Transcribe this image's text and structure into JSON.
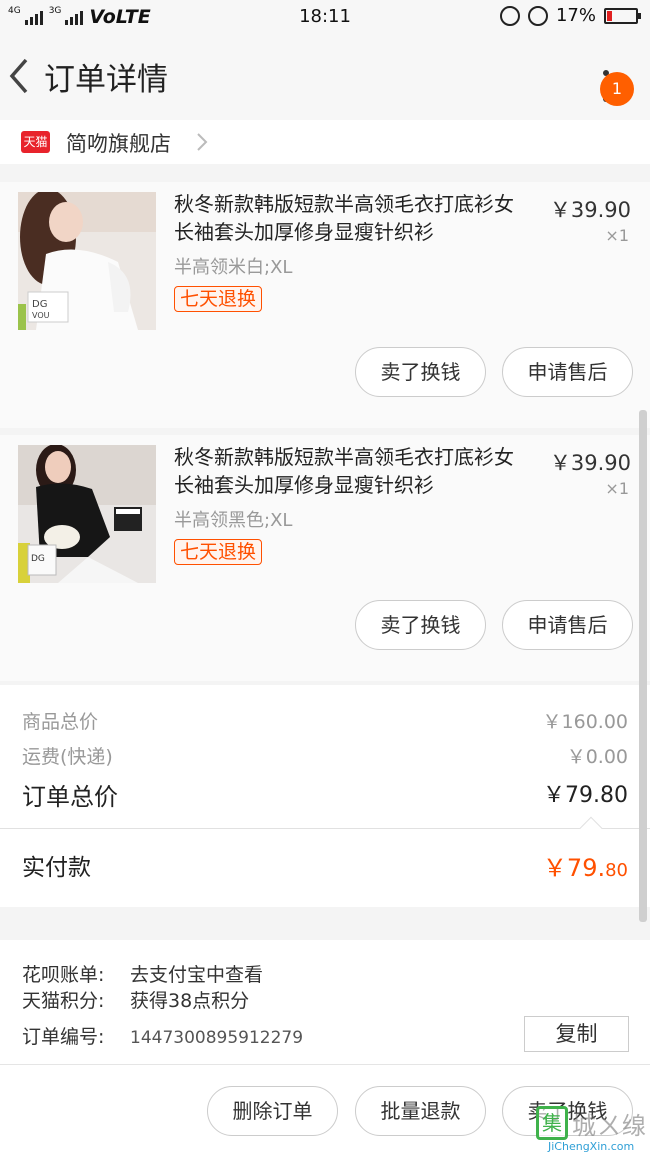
{
  "status_bar": {
    "network_1": "4G",
    "network_2": "3G",
    "volte": "VoLTE",
    "time": "18:11",
    "battery_percent": "17%",
    "battery_level": 0.17
  },
  "nav": {
    "title": "订单详情",
    "badge_count": "1"
  },
  "store": {
    "tmall_badge": "天猫",
    "name": "简吻旗舰店"
  },
  "items": [
    {
      "title": "秋冬新款韩版短款半高领毛衣打底衫女长袖套头加厚修身显瘦针织衫",
      "sku": "半高领米白;XL",
      "tag": "七天退换",
      "price": "￥39.90",
      "qty": "×1",
      "action_sell": "卖了换钱",
      "action_after_sale": "申请售后"
    },
    {
      "title": "秋冬新款韩版短款半高领毛衣打底衫女长袖套头加厚修身显瘦针织衫",
      "sku": "半高领黑色;XL",
      "tag": "七天退换",
      "price": "￥39.90",
      "qty": "×1",
      "action_sell": "卖了换钱",
      "action_after_sale": "申请售后"
    }
  ],
  "summary": {
    "goods_total_label": "商品总价",
    "goods_total_value": "￥160.00",
    "shipping_label": "运费(快递)",
    "shipping_value": "￥0.00",
    "order_total_label": "订单总价",
    "order_total_value": "￥79.80",
    "paid_label": "实付款",
    "paid_value_int": "￥79.",
    "paid_value_dec": "80"
  },
  "info": {
    "huabei_label": "花呗账单:",
    "huabei_value": "去支付宝中查看",
    "points_label": "天猫积分:",
    "points_value": "获得38点积分",
    "order_no_label": "订单编号:",
    "order_no_value": "1447300895912279",
    "copy_label": "复制"
  },
  "bottom_actions": {
    "delete": "删除订单",
    "batch_refund": "批量退款",
    "sell": "卖了换钱"
  },
  "watermark": {
    "logo_char": "集",
    "text": "城ㄨ缐",
    "url": "JiChengXin.com"
  }
}
